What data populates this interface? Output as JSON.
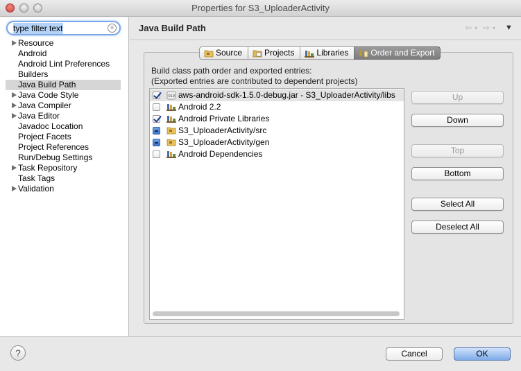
{
  "window": {
    "title": "Properties for S3_UploaderActivity"
  },
  "filter": {
    "placeholder": "type filter text",
    "value": "type filter text"
  },
  "tree": {
    "items": [
      {
        "label": "Resource",
        "expandable": true
      },
      {
        "label": "Android",
        "expandable": false
      },
      {
        "label": "Android Lint Preferences",
        "expandable": false
      },
      {
        "label": "Builders",
        "expandable": false
      },
      {
        "label": "Java Build Path",
        "expandable": false,
        "selected": true
      },
      {
        "label": "Java Code Style",
        "expandable": true
      },
      {
        "label": "Java Compiler",
        "expandable": true
      },
      {
        "label": "Java Editor",
        "expandable": true
      },
      {
        "label": "Javadoc Location",
        "expandable": false
      },
      {
        "label": "Project Facets",
        "expandable": false
      },
      {
        "label": "Project References",
        "expandable": false
      },
      {
        "label": "Run/Debug Settings",
        "expandable": false
      },
      {
        "label": "Task Repository",
        "expandable": true
      },
      {
        "label": "Task Tags",
        "expandable": false
      },
      {
        "label": "Validation",
        "expandable": true
      }
    ]
  },
  "page": {
    "title": "Java Build Path"
  },
  "tabs": [
    {
      "label": "Source",
      "icon": "source-folder-icon"
    },
    {
      "label": "Projects",
      "icon": "projects-icon"
    },
    {
      "label": "Libraries",
      "icon": "libraries-icon"
    },
    {
      "label": "Order and Export",
      "icon": "order-export-icon",
      "active": true
    }
  ],
  "description": {
    "line1": "Build class path order and exported entries:",
    "line2": "(Exported entries are contributed to dependent projects)"
  },
  "entries": [
    {
      "label": "aws-android-sdk-1.5.0-debug.jar - S3_UploaderActivity/libs",
      "state": "checked",
      "icon": "jar-icon",
      "selected": true
    },
    {
      "label": "Android 2.2",
      "state": "unchecked",
      "icon": "library-icon"
    },
    {
      "label": "Android Private Libraries",
      "state": "checked",
      "icon": "library-icon"
    },
    {
      "label": "S3_UploaderActivity/src",
      "state": "mixed",
      "icon": "source-folder-icon"
    },
    {
      "label": "S3_UploaderActivity/gen",
      "state": "mixed",
      "icon": "source-folder-icon"
    },
    {
      "label": "Android Dependencies",
      "state": "unchecked",
      "icon": "library-icon"
    }
  ],
  "buttons": {
    "up": "Up",
    "down": "Down",
    "top": "Top",
    "bottom": "Bottom",
    "select_all": "Select All",
    "deselect_all": "Deselect All"
  },
  "footer": {
    "help": "?",
    "cancel": "Cancel",
    "ok": "OK"
  },
  "colors": {
    "accent": "#7aa7e6",
    "ok_button": "#7fabe8",
    "active_tab": "#8a8a8a"
  }
}
